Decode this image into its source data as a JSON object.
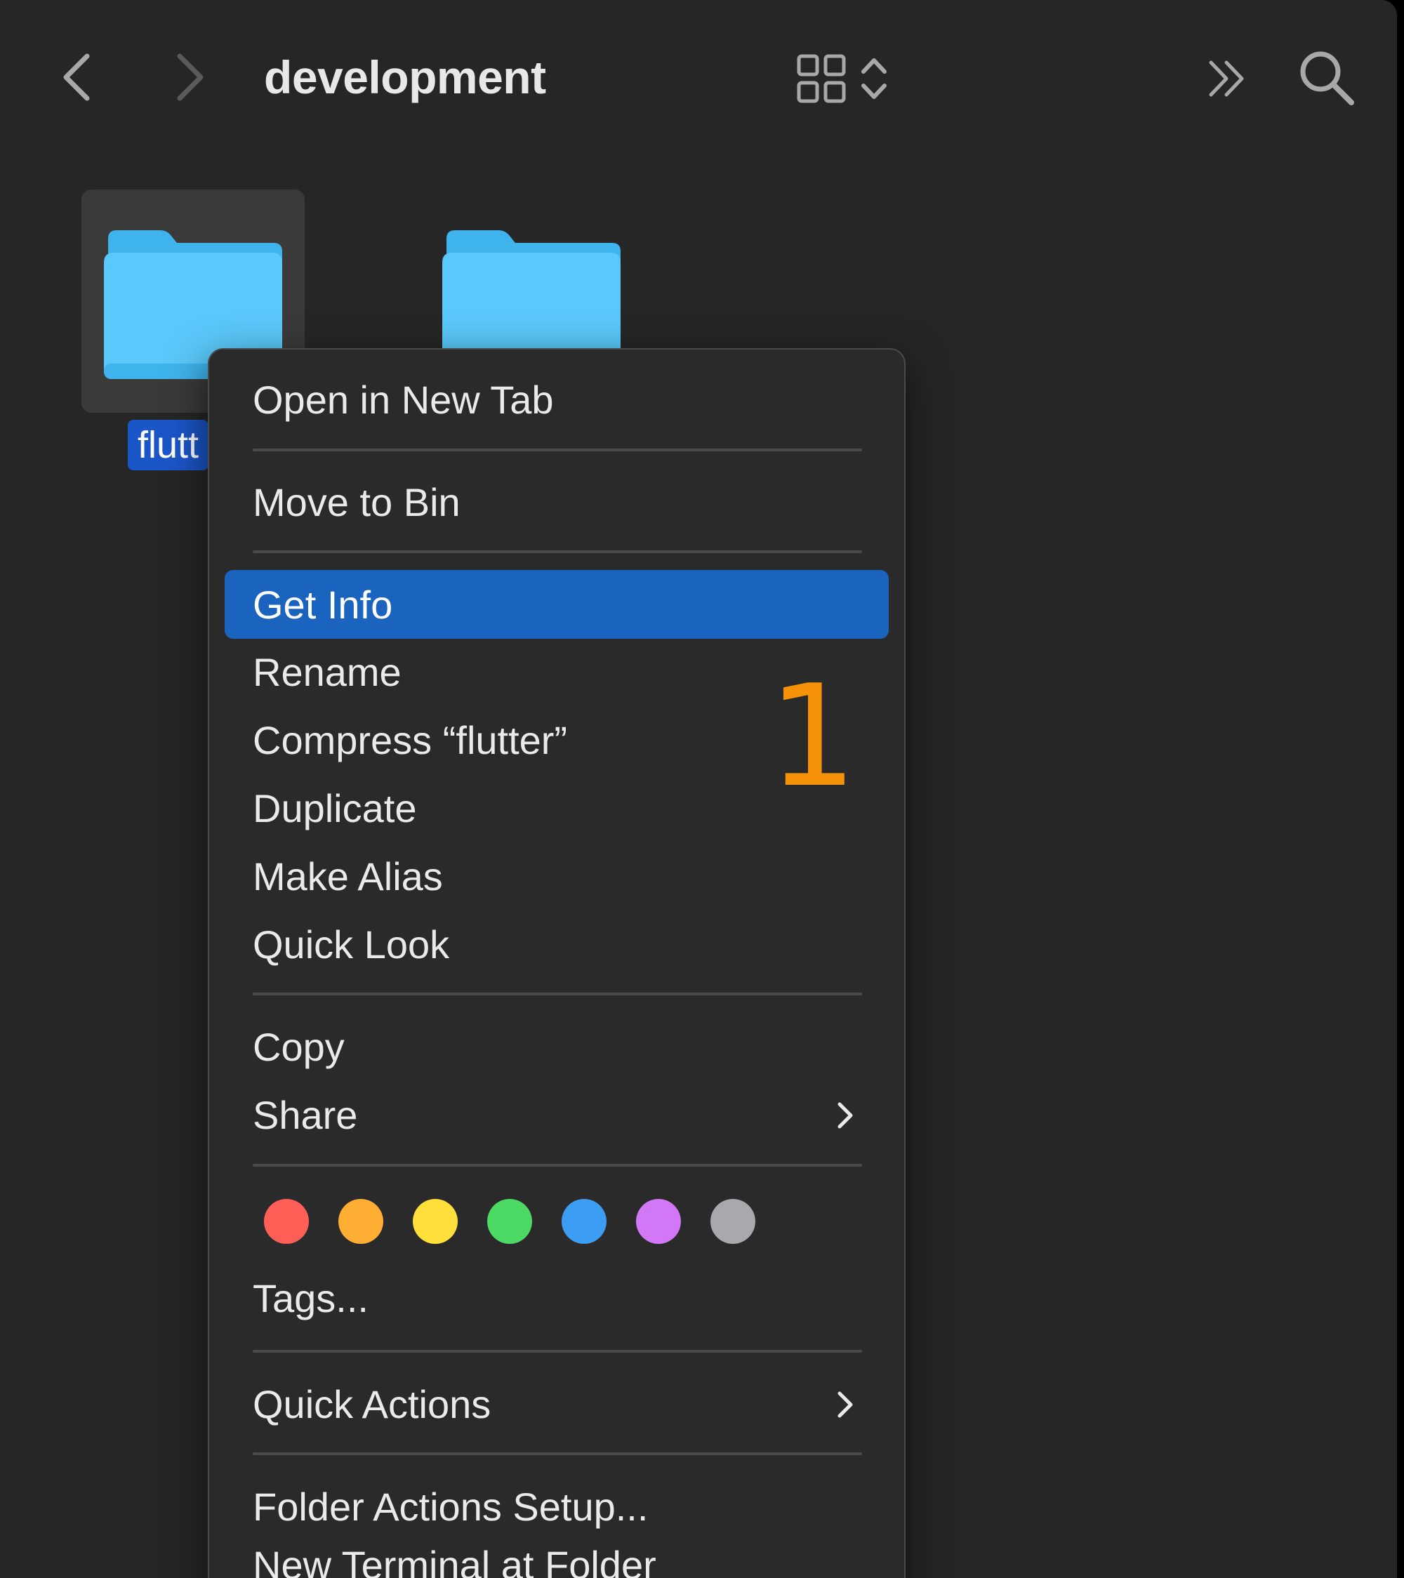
{
  "window": {
    "title": "development"
  },
  "toolbar": {
    "back_icon": "chevron-left-icon",
    "forward_icon": "chevron-right-icon",
    "view_icon": "grid-view-icon",
    "sort_icon": "up-down-chevron-icon",
    "more_icon": "double-chevron-right-icon",
    "search_icon": "magnifying-glass-icon"
  },
  "folders": [
    {
      "name": "flutt",
      "selected": true,
      "color": "#5ac8fa"
    },
    {
      "name": "",
      "selected": false,
      "color": "#5ac8fa"
    }
  ],
  "context_menu": {
    "items": {
      "open_new_tab": "Open in New Tab",
      "move_to_bin": "Move to Bin",
      "get_info": "Get Info",
      "rename": "Rename",
      "compress": "Compress “flutter”",
      "duplicate": "Duplicate",
      "make_alias": "Make Alias",
      "quick_look": "Quick Look",
      "copy": "Copy",
      "share": "Share",
      "tags": "Tags...",
      "quick_actions": "Quick Actions",
      "folder_actions": "Folder Actions Setup...",
      "new_terminal": "New Terminal at Folder"
    },
    "highlighted": "Get Info",
    "tag_colors": [
      "#ff5f57",
      "#ffae34",
      "#ffe03a",
      "#4cd964",
      "#3d9df5",
      "#d277f5",
      "#a8a8ad"
    ],
    "highlight_color": "#1a63bf"
  },
  "annotation": {
    "step": "1",
    "color": "#f5920a"
  }
}
